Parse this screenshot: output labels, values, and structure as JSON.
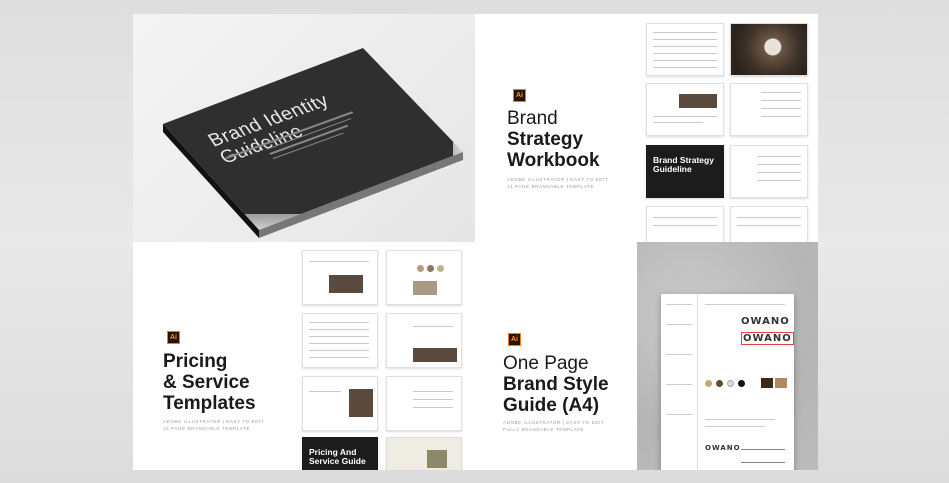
{
  "panels": {
    "identity": {
      "book_title_line1": "Brand Identity",
      "book_title_line2": "Guideline"
    },
    "strategy": {
      "app_badge": "Ai",
      "title_line1": "Brand",
      "title_line2": "Strategy",
      "title_line3": "Workbook",
      "subtitle_line1": "ADOBE ILLUSTRATOR | EASY TO EDIT",
      "subtitle_line2": "14 PAGE BRANDABLE TEMPLATE",
      "preview_cover_line1": "Brand Strategy",
      "preview_cover_line2": "Guideline"
    },
    "pricing": {
      "app_badge": "Ai",
      "title_line1": "Pricing",
      "title_line2": "& Service",
      "title_line3": "Templates",
      "subtitle_line1": "ADOBE ILLUSTRATOR | EASY TO EDIT",
      "subtitle_line2": "15 PAGE BRANDABLE TEMPLATE",
      "preview_cover_line1": "Pricing And",
      "preview_cover_line2": "Service Guide"
    },
    "style_guide": {
      "app_badge": "Ai",
      "title_line1": "One Page",
      "title_line2": "Brand Style",
      "title_line3": "Guide (A4)",
      "subtitle_line1": "ADOBE ILLUSTRATOR | EASY TO EDIT",
      "subtitle_line2": "FULLY BRANDABLE TEMPLATE",
      "logo_text": "OWANO"
    }
  },
  "colors": {
    "accent_orange": "#ff7a00",
    "cover_dark": "#2f2f2f",
    "photo_brown": "#5a4a3e"
  }
}
